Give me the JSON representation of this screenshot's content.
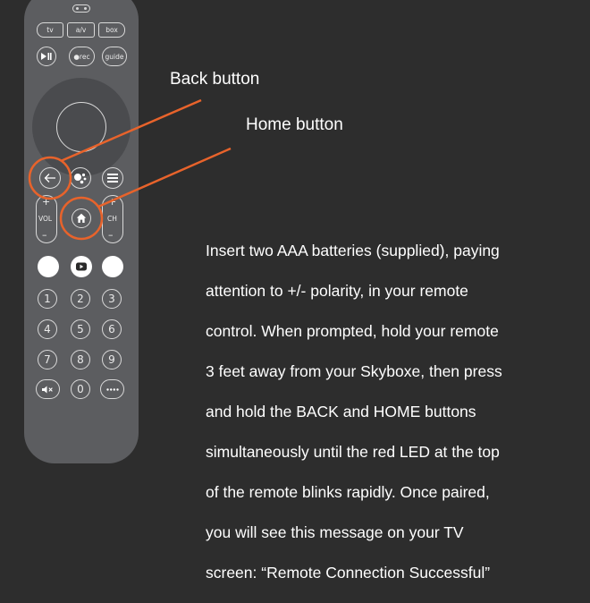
{
  "remote": {
    "top_row": [
      "tv",
      "a/v",
      "box"
    ],
    "second_row": {
      "play_pause_icon": "play-pause-icon",
      "rec": "●rec",
      "guide": "guide"
    },
    "vol_label": "VOL",
    "ch_label": "CH",
    "plus": "+",
    "minus": "–",
    "numbers": [
      "1",
      "2",
      "3",
      "4",
      "5",
      "6",
      "7",
      "8",
      "9",
      "0"
    ],
    "mute_icon": "mute-icon",
    "more_icon": "more-dots-icon",
    "back_icon": "back-arrow-icon",
    "assistant_icon": "assistant-icon",
    "menu_icon": "menu-icon",
    "home_icon": "home-icon",
    "youtube_icon": "youtube-icon"
  },
  "annotations": {
    "back_label": "Back button",
    "home_label": "Home button",
    "callout_color": "#e8632b"
  },
  "instructions": [
    "Insert two AAA batteries (supplied), paying",
    "attention to +/- polarity, in your remote",
    "control. When prompted, hold your remote",
    "3 feet away from your Skyboxe, then press",
    "and hold the BACK and HOME buttons",
    "simultaneously until the red LED at the top",
    "of the remote blinks rapidly. Once paired,",
    "you will see this message on your TV",
    "screen: “Remote Connection Successful”"
  ]
}
